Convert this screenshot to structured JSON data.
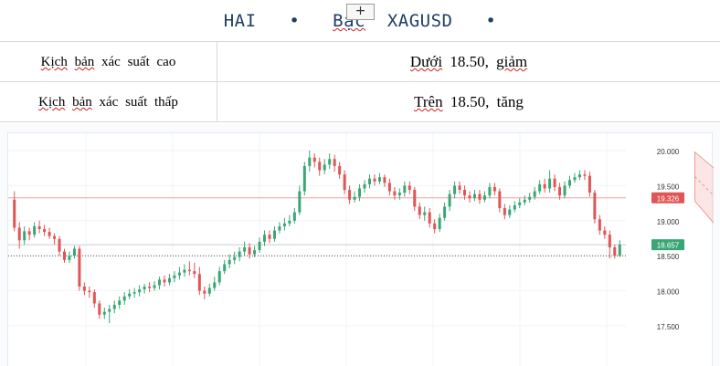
{
  "header": {
    "title_part1": "HAI",
    "title_bullet1": "•",
    "title_part2": "Bạc",
    "title_part3": "XAGUSD",
    "title_bullet2": "•",
    "add_label": "+"
  },
  "scenarios": [
    {
      "label": "Kịch bản xác suất cao",
      "value": "Dưới 18.50, giảm"
    },
    {
      "label": "Kịch bản xác suất thấp",
      "value": "Trên 18.50, tăng"
    }
  ],
  "chart_data": {
    "type": "candlestick",
    "symbol": "XAGUSD",
    "y_ticks": [
      "20.000",
      "19.500",
      "19.000",
      "18.500",
      "18.000",
      "17.500"
    ],
    "ylim": [
      17.3,
      20.15
    ],
    "price_labels": [
      {
        "text": "19.326",
        "value": 19.326,
        "color": "#e05555"
      },
      {
        "text": "18.657",
        "value": 18.657,
        "color": "#3aa676"
      }
    ],
    "horizontal_lines": [
      {
        "value": 19.326,
        "style": "solid",
        "color": "#f0a0a0"
      },
      {
        "value": 18.657,
        "style": "solid",
        "color": "#c8ccd2"
      },
      {
        "value": 18.5,
        "style": "dotted",
        "color": "#555555"
      }
    ],
    "channel": {
      "upper": [
        [
          136,
          19.98
        ],
        [
          146,
          19.38
        ]
      ],
      "lower": [
        [
          136,
          19.28
        ],
        [
          146,
          18.45
        ]
      ],
      "fill": "#f6c5c5"
    },
    "up_color": "#3aa676",
    "down_color": "#e05555",
    "candles": [
      [
        19.3,
        18.9,
        19.42,
        18.85
      ],
      [
        18.9,
        18.72,
        18.98,
        18.6
      ],
      [
        18.72,
        18.85,
        18.92,
        18.66
      ],
      [
        18.85,
        18.8,
        18.9,
        18.72
      ],
      [
        18.8,
        18.92,
        18.98,
        18.76
      ],
      [
        18.92,
        18.88,
        19.0,
        18.82
      ],
      [
        18.88,
        18.84,
        18.94,
        18.78
      ],
      [
        18.84,
        18.78,
        18.9,
        18.74
      ],
      [
        18.78,
        18.74,
        18.82,
        18.66
      ],
      [
        18.74,
        18.56,
        18.78,
        18.5
      ],
      [
        18.56,
        18.44,
        18.6,
        18.4
      ],
      [
        18.44,
        18.5,
        18.56,
        18.4
      ],
      [
        18.5,
        18.6,
        18.64,
        18.46
      ],
      [
        18.6,
        18.06,
        18.64,
        18.0
      ],
      [
        18.06,
        18.0,
        18.12,
        17.94
      ],
      [
        18.0,
        17.98,
        18.06,
        17.9
      ],
      [
        17.98,
        17.82,
        18.02,
        17.76
      ],
      [
        17.82,
        17.66,
        17.86,
        17.6
      ],
      [
        17.66,
        17.7,
        17.76,
        17.6
      ],
      [
        17.7,
        17.74,
        17.8,
        17.54
      ],
      [
        17.74,
        17.8,
        17.86,
        17.68
      ],
      [
        17.8,
        17.86,
        17.92,
        17.74
      ],
      [
        17.86,
        17.92,
        17.98,
        17.8
      ],
      [
        17.92,
        17.96,
        18.02,
        17.88
      ],
      [
        17.96,
        17.98,
        18.04,
        17.9
      ],
      [
        17.98,
        18.02,
        18.08,
        17.92
      ],
      [
        18.02,
        18.06,
        18.1,
        17.96
      ],
      [
        18.06,
        18.04,
        18.12,
        17.98
      ],
      [
        18.04,
        18.08,
        18.14,
        18.0
      ],
      [
        18.08,
        18.16,
        18.2,
        18.02
      ],
      [
        18.16,
        18.12,
        18.22,
        18.06
      ],
      [
        18.12,
        18.18,
        18.24,
        18.08
      ],
      [
        18.18,
        18.22,
        18.28,
        18.12
      ],
      [
        18.22,
        18.26,
        18.34,
        18.16
      ],
      [
        18.26,
        18.3,
        18.38,
        18.2
      ],
      [
        18.3,
        18.28,
        18.42,
        18.22
      ],
      [
        18.28,
        18.24,
        18.4,
        18.18
      ],
      [
        18.24,
        18.0,
        18.34,
        17.94
      ],
      [
        18.0,
        17.96,
        18.06,
        17.88
      ],
      [
        17.96,
        18.04,
        18.1,
        17.92
      ],
      [
        18.04,
        18.12,
        18.2,
        18.0
      ],
      [
        18.12,
        18.28,
        18.34,
        18.08
      ],
      [
        18.28,
        18.38,
        18.44,
        18.24
      ],
      [
        18.38,
        18.44,
        18.52,
        18.32
      ],
      [
        18.44,
        18.48,
        18.56,
        18.38
      ],
      [
        18.48,
        18.56,
        18.62,
        18.42
      ],
      [
        18.56,
        18.62,
        18.7,
        18.5
      ],
      [
        18.62,
        18.52,
        18.68,
        18.46
      ],
      [
        18.52,
        18.58,
        18.64,
        18.48
      ],
      [
        18.58,
        18.7,
        18.76,
        18.54
      ],
      [
        18.7,
        18.8,
        18.86,
        18.64
      ],
      [
        18.8,
        18.74,
        18.86,
        18.68
      ],
      [
        18.74,
        18.86,
        18.92,
        18.7
      ],
      [
        18.86,
        18.92,
        18.98,
        18.82
      ],
      [
        18.92,
        18.96,
        19.04,
        18.86
      ],
      [
        18.96,
        19.0,
        19.08,
        18.92
      ],
      [
        19.0,
        19.12,
        19.18,
        18.96
      ],
      [
        19.12,
        19.42,
        19.5,
        19.08
      ],
      [
        19.42,
        19.78,
        19.84,
        19.36
      ],
      [
        19.78,
        19.9,
        20.0,
        19.7
      ],
      [
        19.9,
        19.84,
        19.96,
        19.76
      ],
      [
        19.84,
        19.72,
        19.9,
        19.64
      ],
      [
        19.72,
        19.8,
        19.88,
        19.66
      ],
      [
        19.8,
        19.88,
        19.96,
        19.74
      ],
      [
        19.88,
        19.78,
        19.94,
        19.7
      ],
      [
        19.78,
        19.66,
        19.84,
        19.6
      ],
      [
        19.66,
        19.44,
        19.72,
        19.38
      ],
      [
        19.44,
        19.3,
        19.5,
        19.24
      ],
      [
        19.3,
        19.34,
        19.42,
        19.26
      ],
      [
        19.34,
        19.46,
        19.52,
        19.28
      ],
      [
        19.46,
        19.52,
        19.58,
        19.4
      ],
      [
        19.52,
        19.6,
        19.66,
        19.46
      ],
      [
        19.6,
        19.56,
        19.66,
        19.5
      ],
      [
        19.56,
        19.62,
        19.68,
        19.52
      ],
      [
        19.62,
        19.54,
        19.66,
        19.48
      ],
      [
        19.54,
        19.42,
        19.6,
        19.36
      ],
      [
        19.42,
        19.36,
        19.48,
        19.3
      ],
      [
        19.36,
        19.4,
        19.46,
        19.3
      ],
      [
        19.4,
        19.5,
        19.56,
        19.34
      ],
      [
        19.5,
        19.44,
        19.56,
        19.38
      ],
      [
        19.44,
        19.2,
        19.48,
        19.14
      ],
      [
        19.2,
        19.08,
        19.26,
        19.02
      ],
      [
        19.08,
        19.12,
        19.2,
        19.0
      ],
      [
        19.12,
        18.96,
        19.18,
        18.9
      ],
      [
        18.96,
        18.88,
        19.02,
        18.82
      ],
      [
        18.88,
        19.04,
        19.1,
        18.84
      ],
      [
        19.04,
        19.2,
        19.26,
        19.0
      ],
      [
        19.2,
        19.38,
        19.44,
        19.14
      ],
      [
        19.38,
        19.5,
        19.56,
        19.32
      ],
      [
        19.5,
        19.44,
        19.56,
        19.38
      ],
      [
        19.44,
        19.36,
        19.5,
        19.3
      ],
      [
        19.36,
        19.32,
        19.42,
        19.26
      ],
      [
        19.32,
        19.38,
        19.44,
        19.28
      ],
      [
        19.38,
        19.3,
        19.44,
        19.24
      ],
      [
        19.3,
        19.36,
        19.42,
        19.26
      ],
      [
        19.36,
        19.48,
        19.54,
        19.32
      ],
      [
        19.48,
        19.42,
        19.54,
        19.36
      ],
      [
        19.42,
        19.18,
        19.46,
        19.12
      ],
      [
        19.18,
        19.08,
        19.24,
        19.02
      ],
      [
        19.08,
        19.16,
        19.22,
        19.04
      ],
      [
        19.16,
        19.22,
        19.28,
        19.12
      ],
      [
        19.22,
        19.26,
        19.32,
        19.18
      ],
      [
        19.26,
        19.3,
        19.36,
        19.22
      ],
      [
        19.3,
        19.34,
        19.4,
        19.26
      ],
      [
        19.34,
        19.42,
        19.48,
        19.3
      ],
      [
        19.42,
        19.52,
        19.58,
        19.38
      ],
      [
        19.52,
        19.46,
        19.6,
        19.4
      ],
      [
        19.46,
        19.6,
        19.72,
        19.4
      ],
      [
        19.6,
        19.48,
        19.66,
        19.42
      ],
      [
        19.48,
        19.36,
        19.54,
        19.3
      ],
      [
        19.36,
        19.5,
        19.56,
        19.32
      ],
      [
        19.5,
        19.58,
        19.64,
        19.46
      ],
      [
        19.58,
        19.62,
        19.68,
        19.54
      ],
      [
        19.62,
        19.66,
        19.72,
        19.58
      ],
      [
        19.66,
        19.64,
        19.72,
        19.58
      ],
      [
        19.64,
        19.4,
        19.7,
        19.34
      ],
      [
        19.4,
        19.02,
        19.44,
        18.96
      ],
      [
        19.02,
        18.86,
        19.08,
        18.8
      ],
      [
        18.86,
        18.8,
        18.92,
        18.74
      ],
      [
        18.8,
        18.62,
        18.86,
        18.46
      ],
      [
        18.62,
        18.5,
        18.66,
        18.46
      ],
      [
        18.5,
        18.66,
        18.72,
        18.48
      ]
    ]
  }
}
